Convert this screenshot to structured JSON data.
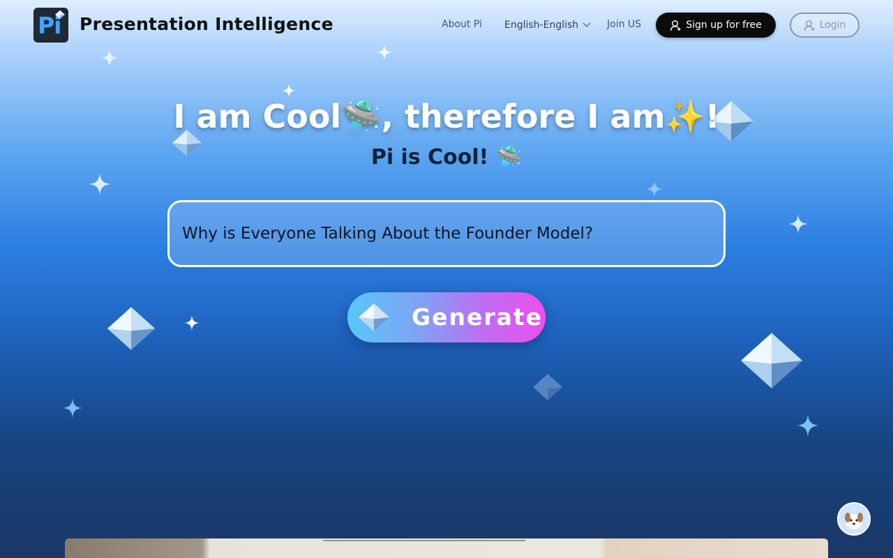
{
  "header": {
    "logo_text": "Pi",
    "brand": "Presentation Intelligence",
    "nav": {
      "about": "About Pi",
      "language": "English-English",
      "join": "Join US"
    },
    "signup_label": "Sign up for free",
    "login_label": "Login"
  },
  "hero": {
    "title": "I am Cool🛸, therefore I am✨!",
    "subtitle": "Pi is Cool! 🛸",
    "prompt_value": "Why is Everyone Talking About the Founder Model?",
    "generate_label": "Generate"
  },
  "icons": {
    "user": "user-icon",
    "user_plus": "user-plus-icon",
    "chevron": "chevron-down-icon",
    "diamond": "diamond-icon",
    "sparkle": "sparkle-icon",
    "mascot": "dog-mascot-icon"
  },
  "colors": {
    "signup_bg": "#0c0c0c",
    "generate_gradient_start": "#59c7f7",
    "generate_gradient_end": "#ee4ff0",
    "subtitle": "#14233a"
  }
}
